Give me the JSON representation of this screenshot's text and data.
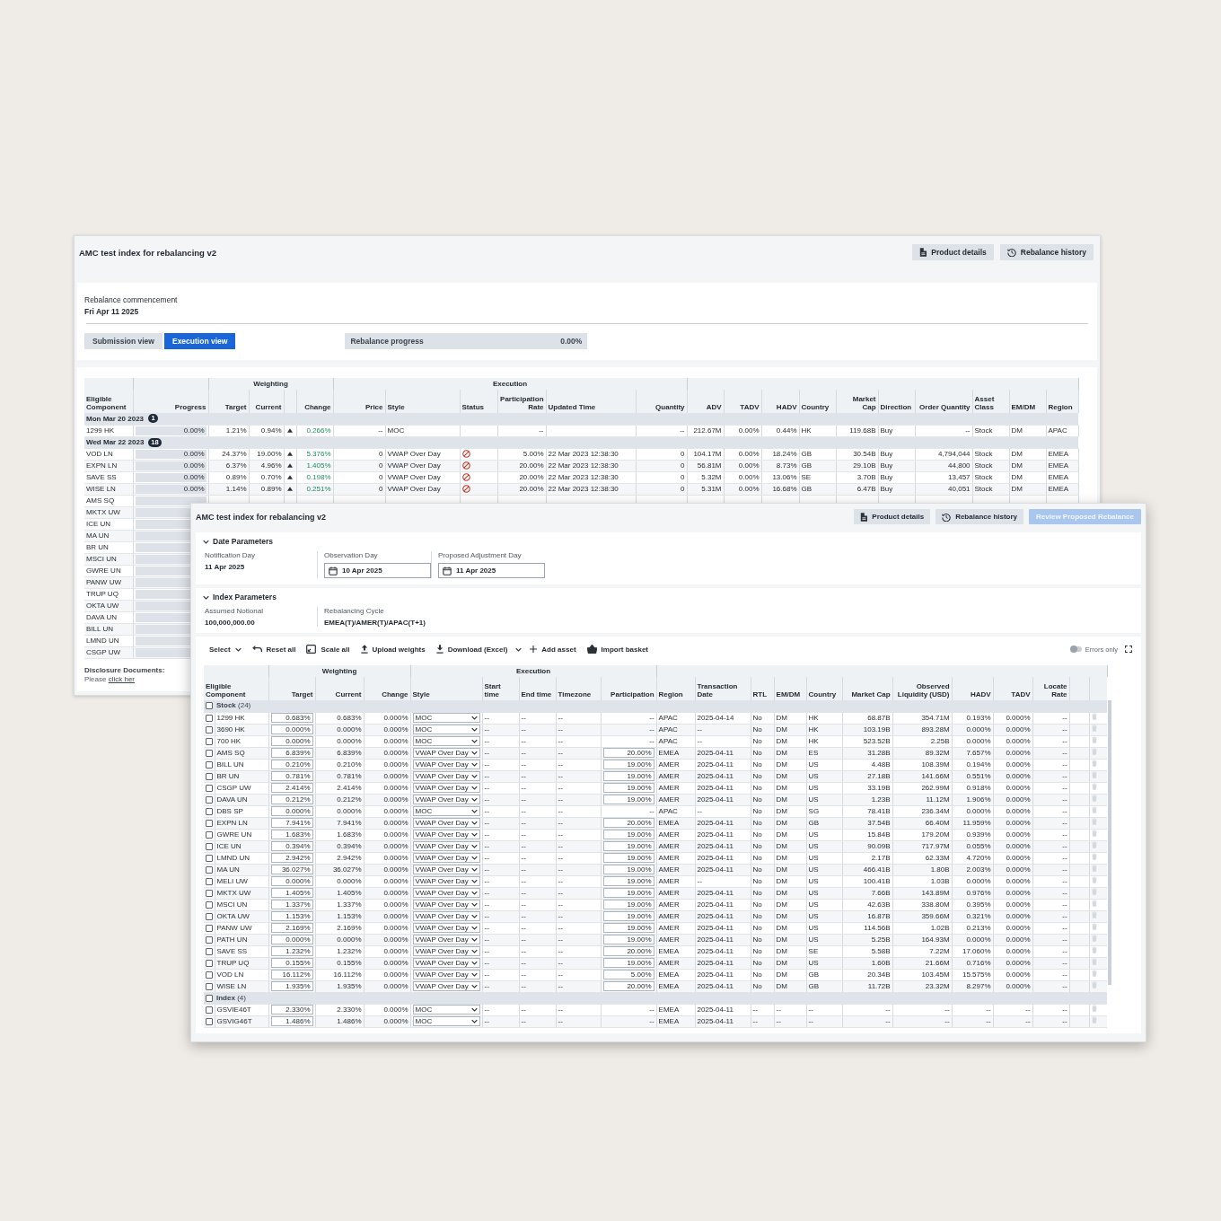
{
  "back_window": {
    "title": "AMC test index for rebalancing v2",
    "buttons": [
      {
        "label": "Product details"
      },
      {
        "label": "Rebalance history"
      }
    ],
    "commencement": {
      "label": "Rebalance commencement",
      "value": "Fri Apr 11 2025"
    },
    "view_tabs": [
      {
        "label": "Submission view",
        "selected": false
      },
      {
        "label": "Execution view",
        "selected": true
      }
    ],
    "progress": {
      "label": "Rebalance progress",
      "reading": "0.00%",
      "level": 0
    },
    "table": {
      "column_groups": [
        {
          "label": "Weighting"
        },
        {
          "label": "Execution"
        }
      ],
      "columns": [
        {
          "label": "Eligible Component"
        },
        {
          "label": "Progress",
          "kind": "progress"
        },
        {
          "label": "Target"
        },
        {
          "label": "Current"
        },
        {
          "kind": "trend"
        },
        {
          "label": "Change",
          "kind": "change"
        },
        {
          "label": "Price"
        },
        {
          "label": "Style"
        },
        {
          "label": "Status",
          "kind": "status"
        },
        {
          "label": "Participation Rate"
        },
        {
          "label": "Updated Time"
        },
        {
          "label": "Quantity"
        },
        {
          "label": "ADV"
        },
        {
          "label": "TADV"
        },
        {
          "label": "HADV"
        },
        {
          "label": "Country"
        },
        {
          "label": "Market Cap"
        },
        {
          "label": "Direction"
        },
        {
          "label": "Order Quantity"
        },
        {
          "label": "Asset Class"
        },
        {
          "label": "EM/DM"
        },
        {
          "label": "Region"
        }
      ],
      "rows": [
        {
          "kind": "date",
          "label": "Mon Mar 20 2023",
          "count": "1"
        },
        {
          "kind": "item",
          "component": "1299 HK",
          "progress": "0.00%",
          "level": 0,
          "target": "1.21%",
          "current": "0.94%",
          "rising": true,
          "change": "0.266%",
          "price": "--",
          "style": "MOC",
          "blocked": false,
          "participation_rate": "--",
          "quantity": "--",
          "adv": "212.67M",
          "tadv": "0.00%",
          "hadv": "0.44%",
          "country": "HK",
          "market_cap": "119.68B",
          "direction": "Buy",
          "order_quantity": "--",
          "asset_class": "Stock",
          "em_dm": "DM",
          "region": "APAC"
        },
        {
          "kind": "date",
          "label": "Wed Mar 22 2023",
          "count": "18"
        },
        {
          "kind": "item",
          "component": "VOD LN",
          "progress": "0.00%",
          "level": 0,
          "target": "24.37%",
          "current": "19.00%",
          "rising": true,
          "change": "5.376%",
          "price": "0",
          "style": "VWAP Over Day",
          "blocked": true,
          "participation_rate": "5.00%",
          "updated_time": "22 Mar 2023 12:38:30",
          "quantity": "0",
          "adv": "104.17M",
          "tadv": "0.00%",
          "hadv": "18.24%",
          "country": "GB",
          "market_cap": "30.54B",
          "direction": "Buy",
          "order_quantity": "4,794,044",
          "asset_class": "Stock",
          "em_dm": "DM",
          "region": "EMEA"
        },
        {
          "kind": "item",
          "component": "EXPN LN",
          "progress": "0.00%",
          "level": 0,
          "target": "6.37%",
          "current": "4.96%",
          "rising": true,
          "change": "1.405%",
          "price": "0",
          "style": "VWAP Over Day",
          "blocked": true,
          "participation_rate": "20.00%",
          "updated_time": "22 Mar 2023 12:38:30",
          "quantity": "0",
          "adv": "56.81M",
          "tadv": "0.00%",
          "hadv": "8.73%",
          "country": "GB",
          "market_cap": "29.10B",
          "direction": "Buy",
          "order_quantity": "44,800",
          "asset_class": "Stock",
          "em_dm": "DM",
          "region": "EMEA"
        },
        {
          "kind": "item",
          "component": "SAVE SS",
          "progress": "0.00%",
          "level": 0,
          "target": "0.89%",
          "current": "0.70%",
          "rising": true,
          "change": "0.198%",
          "price": "0",
          "style": "VWAP Over Day",
          "blocked": true,
          "participation_rate": "20.00%",
          "updated_time": "22 Mar 2023 12:38:30",
          "quantity": "0",
          "adv": "5.32M",
          "tadv": "0.00%",
          "hadv": "13.06%",
          "country": "SE",
          "market_cap": "3.70B",
          "direction": "Buy",
          "order_quantity": "13,457",
          "asset_class": "Stock",
          "em_dm": "DM",
          "region": "EMEA"
        },
        {
          "kind": "item",
          "component": "WISE LN",
          "progress": "0.00%",
          "level": 0,
          "target": "1.14%",
          "current": "0.89%",
          "rising": true,
          "change": "0.251%",
          "price": "0",
          "style": "VWAP Over Day",
          "blocked": true,
          "participation_rate": "20.00%",
          "updated_time": "22 Mar 2023 12:38:30",
          "quantity": "0",
          "adv": "5.31M",
          "tadv": "0.00%",
          "hadv": "16.68%",
          "country": "GB",
          "market_cap": "6.47B",
          "direction": "Buy",
          "order_quantity": "40,051",
          "asset_class": "Stock",
          "em_dm": "DM",
          "region": "EMEA"
        },
        {
          "kind": "item",
          "component": "AMS SQ",
          "level": 0
        },
        {
          "kind": "item",
          "component": "MKTX UW",
          "level": 0
        },
        {
          "kind": "item",
          "component": "ICE UN",
          "level": 0
        },
        {
          "kind": "item",
          "component": "MA UN",
          "level": 0
        },
        {
          "kind": "item",
          "component": "BR UN",
          "level": 0
        },
        {
          "kind": "item",
          "component": "MSCI UN",
          "level": 0
        },
        {
          "kind": "item",
          "component": "GWRE UN",
          "level": 0
        },
        {
          "kind": "item",
          "component": "PANW UW",
          "level": 0
        },
        {
          "kind": "item",
          "component": "TRUP UQ",
          "level": 0
        },
        {
          "kind": "item",
          "component": "OKTA UW",
          "level": 0
        },
        {
          "kind": "item",
          "component": "DAVA UN",
          "level": 0
        },
        {
          "kind": "item",
          "component": "BILL UN",
          "level": 0
        },
        {
          "kind": "item",
          "component": "LMND UN",
          "level": 0
        },
        {
          "kind": "item",
          "component": "CSGP UW",
          "level": 0
        }
      ]
    },
    "disclosure": {
      "text": "**Disclosure Documents:** Please",
      "link": "click her"
    }
  },
  "front_window": {
    "title": "AMC test index for rebalancing v2",
    "buttons": [
      {
        "label": "Product details",
        "kind": "secondary",
        "disabled": false
      },
      {
        "label": "Rebalance history",
        "kind": "secondary",
        "disabled": false
      },
      {
        "label": "Review Proposed Rebalance",
        "kind": "primary",
        "disabled": true
      }
    ],
    "sections": [
      {
        "title": "Date Parameters",
        "expanded": true,
        "fields": [
          {
            "label": "Notification Day",
            "value": "11 Apr 2025",
            "kind": "text"
          },
          {
            "label": "Observation Day",
            "value": "10 Apr 2025",
            "kind": "date"
          },
          {
            "label": "Proposed Adjustment Day",
            "value": "11 Apr 2025",
            "kind": "date"
          }
        ]
      },
      {
        "title": "Index Parameters",
        "expanded": true,
        "fields": [
          {
            "label": "Assumed Notional",
            "value": "100,000,000.00",
            "kind": "text"
          },
          {
            "label": "Rebalancing Cycle",
            "value": "EMEA(T)/AMER(T)/APAC(T+1)",
            "kind": "text"
          }
        ]
      }
    ],
    "toolbar": [
      {
        "label": "Select",
        "kind": "menu"
      },
      {
        "label": "Reset all",
        "kind": "button"
      },
      {
        "label": "Scale all",
        "kind": "button"
      },
      {
        "label": "Upload weights",
        "kind": "button"
      },
      {
        "label": "Download (Excel)",
        "kind": "split"
      },
      {
        "label": "Add asset",
        "kind": "button"
      },
      {
        "label": "Import basket",
        "kind": "button"
      }
    ],
    "errors_toggle": {
      "label": "Errors only",
      "on": false
    },
    "table": {
      "column_groups": [
        {
          "label": "Weighting"
        },
        {
          "label": "Execution"
        }
      ],
      "columns": [
        {
          "label": "Eligible Component"
        },
        {
          "label": "Target",
          "kind": "field"
        },
        {
          "label": "Current"
        },
        {
          "label": "Change"
        },
        {
          "label": "Style",
          "kind": "select"
        },
        {
          "label": "Start time"
        },
        {
          "label": "End time"
        },
        {
          "label": "Timezone"
        },
        {
          "label": "Participation",
          "kind": "participation"
        },
        {
          "label": "Region"
        },
        {
          "label": "Transaction Date"
        },
        {
          "label": "RTL"
        },
        {
          "label": "EM/DM"
        },
        {
          "label": "Country"
        },
        {
          "label": "Market Cap"
        },
        {
          "label": "Observed Liquidity (USD)"
        },
        {
          "label": "HADV"
        },
        {
          "label": "TADV"
        },
        {
          "label": "Locate Rate"
        }
      ],
      "rows": [
        {
          "kind": "group",
          "label": "**Stock** (24)",
          "checked": false
        },
        {
          "kind": "asset",
          "checked": false,
          "component": "1299 HK",
          "target": "0.683%",
          "current": "0.683%",
          "change": "0.000%",
          "style": "MOC",
          "start_time": "--",
          "end_time": "--",
          "timezone": "--",
          "participation": "--",
          "participation_editable": false,
          "region": "APAC",
          "transaction_date": "2025-04-14",
          "rtl": "No",
          "em_dm": "DM",
          "country": "HK",
          "market_cap": "68.87B",
          "observed_liquidity": "354.71M",
          "hadv": "0.193%",
          "tadv": "0.000%",
          "locate_rate": "--"
        },
        {
          "kind": "asset",
          "checked": false,
          "component": "3690 HK",
          "target": "0.000%",
          "current": "0.000%",
          "change": "0.000%",
          "style": "MOC",
          "start_time": "--",
          "end_time": "--",
          "timezone": "--",
          "participation": "--",
          "participation_editable": false,
          "region": "APAC",
          "transaction_date": "--",
          "rtl": "No",
          "em_dm": "DM",
          "country": "HK",
          "market_cap": "103.19B",
          "observed_liquidity": "893.28M",
          "hadv": "0.000%",
          "tadv": "0.000%",
          "locate_rate": "--"
        },
        {
          "kind": "asset",
          "checked": false,
          "component": "700 HK",
          "target": "0.000%",
          "current": "0.000%",
          "change": "0.000%",
          "style": "MOC",
          "start_time": "--",
          "end_time": "--",
          "timezone": "--",
          "participation": "--",
          "participation_editable": false,
          "region": "APAC",
          "transaction_date": "--",
          "rtl": "No",
          "em_dm": "DM",
          "country": "HK",
          "market_cap": "523.52B",
          "observed_liquidity": "2.25B",
          "hadv": "0.000%",
          "tadv": "0.000%",
          "locate_rate": "--"
        },
        {
          "kind": "asset",
          "checked": false,
          "component": "AMS SQ",
          "target": "6.839%",
          "current": "6.839%",
          "change": "0.000%",
          "style": "VWAP Over Day",
          "start_time": "--",
          "end_time": "--",
          "timezone": "--",
          "participation": "20.00%",
          "participation_editable": true,
          "region": "EMEA",
          "transaction_date": "2025-04-11",
          "rtl": "No",
          "em_dm": "DM",
          "country": "ES",
          "market_cap": "31.28B",
          "observed_liquidity": "89.32M",
          "hadv": "7.657%",
          "tadv": "0.000%",
          "locate_rate": "--"
        },
        {
          "kind": "asset",
          "checked": false,
          "component": "BILL UN",
          "target": "0.210%",
          "current": "0.210%",
          "change": "0.000%",
          "style": "VWAP Over Day",
          "start_time": "--",
          "end_time": "--",
          "timezone": "--",
          "participation": "19.00%",
          "participation_editable": true,
          "region": "AMER",
          "transaction_date": "2025-04-11",
          "rtl": "No",
          "em_dm": "DM",
          "country": "US",
          "market_cap": "4.48B",
          "observed_liquidity": "108.39M",
          "hadv": "0.194%",
          "tadv": "0.000%",
          "locate_rate": "--"
        },
        {
          "kind": "asset",
          "checked": false,
          "component": "BR UN",
          "target": "0.781%",
          "current": "0.781%",
          "change": "0.000%",
          "style": "VWAP Over Day",
          "start_time": "--",
          "end_time": "--",
          "timezone": "--",
          "participation": "19.00%",
          "participation_editable": true,
          "region": "AMER",
          "transaction_date": "2025-04-11",
          "rtl": "No",
          "em_dm": "DM",
          "country": "US",
          "market_cap": "27.18B",
          "observed_liquidity": "141.66M",
          "hadv": "0.551%",
          "tadv": "0.000%",
          "locate_rate": "--"
        },
        {
          "kind": "asset",
          "checked": false,
          "component": "CSGP UW",
          "target": "2.414%",
          "current": "2.414%",
          "change": "0.000%",
          "style": "VWAP Over Day",
          "start_time": "--",
          "end_time": "--",
          "timezone": "--",
          "participation": "19.00%",
          "participation_editable": true,
          "region": "AMER",
          "transaction_date": "2025-04-11",
          "rtl": "No",
          "em_dm": "DM",
          "country": "US",
          "market_cap": "33.19B",
          "observed_liquidity": "262.99M",
          "hadv": "0.918%",
          "tadv": "0.000%",
          "locate_rate": "--"
        },
        {
          "kind": "asset",
          "checked": false,
          "component": "DAVA UN",
          "target": "0.212%",
          "current": "0.212%",
          "change": "0.000%",
          "style": "VWAP Over Day",
          "start_time": "--",
          "end_time": "--",
          "timezone": "--",
          "participation": "19.00%",
          "participation_editable": true,
          "region": "AMER",
          "transaction_date": "2025-04-11",
          "rtl": "No",
          "em_dm": "DM",
          "country": "US",
          "market_cap": "1.23B",
          "observed_liquidity": "11.12M",
          "hadv": "1.906%",
          "tadv": "0.000%",
          "locate_rate": "--"
        },
        {
          "kind": "asset",
          "checked": false,
          "component": "DBS SP",
          "target": "0.000%",
          "current": "0.000%",
          "change": "0.000%",
          "style": "MOC",
          "start_time": "--",
          "end_time": "--",
          "timezone": "--",
          "participation": "--",
          "participation_editable": false,
          "region": "APAC",
          "transaction_date": "--",
          "rtl": "No",
          "em_dm": "DM",
          "country": "SG",
          "market_cap": "78.41B",
          "observed_liquidity": "236.34M",
          "hadv": "0.000%",
          "tadv": "0.000%",
          "locate_rate": "--"
        },
        {
          "kind": "asset",
          "checked": false,
          "component": "EXPN LN",
          "target": "7.941%",
          "current": "7.941%",
          "change": "0.000%",
          "style": "VWAP Over Day",
          "start_time": "--",
          "end_time": "--",
          "timezone": "--",
          "participation": "20.00%",
          "participation_editable": true,
          "region": "EMEA",
          "transaction_date": "2025-04-11",
          "rtl": "No",
          "em_dm": "DM",
          "country": "GB",
          "market_cap": "37.54B",
          "observed_liquidity": "66.40M",
          "hadv": "11.959%",
          "tadv": "0.000%",
          "locate_rate": "--"
        },
        {
          "kind": "asset",
          "checked": false,
          "component": "GWRE UN",
          "target": "1.683%",
          "current": "1.683%",
          "change": "0.000%",
          "style": "VWAP Over Day",
          "start_time": "--",
          "end_time": "--",
          "timezone": "--",
          "participation": "19.00%",
          "participation_editable": true,
          "region": "AMER",
          "transaction_date": "2025-04-11",
          "rtl": "No",
          "em_dm": "DM",
          "country": "US",
          "market_cap": "15.84B",
          "observed_liquidity": "179.20M",
          "hadv": "0.939%",
          "tadv": "0.000%",
          "locate_rate": "--"
        },
        {
          "kind": "asset",
          "checked": false,
          "component": "ICE UN",
          "target": "0.394%",
          "current": "0.394%",
          "change": "0.000%",
          "style": "VWAP Over Day",
          "start_time": "--",
          "end_time": "--",
          "timezone": "--",
          "participation": "19.00%",
          "participation_editable": true,
          "region": "AMER",
          "transaction_date": "2025-04-11",
          "rtl": "No",
          "em_dm": "DM",
          "country": "US",
          "market_cap": "90.09B",
          "observed_liquidity": "717.97M",
          "hadv": "0.055%",
          "tadv": "0.000%",
          "locate_rate": "--"
        },
        {
          "kind": "asset",
          "checked": false,
          "component": "LMND UN",
          "target": "2.942%",
          "current": "2.942%",
          "change": "0.000%",
          "style": "VWAP Over Day",
          "start_time": "--",
          "end_time": "--",
          "timezone": "--",
          "participation": "19.00%",
          "participation_editable": true,
          "region": "AMER",
          "transaction_date": "2025-04-11",
          "rtl": "No",
          "em_dm": "DM",
          "country": "US",
          "market_cap": "2.17B",
          "observed_liquidity": "62.33M",
          "hadv": "4.720%",
          "tadv": "0.000%",
          "locate_rate": "--"
        },
        {
          "kind": "asset",
          "checked": false,
          "component": "MA UN",
          "target": "36.027%",
          "current": "36.027%",
          "change": "0.000%",
          "style": "VWAP Over Day",
          "start_time": "--",
          "end_time": "--",
          "timezone": "--",
          "participation": "19.00%",
          "participation_editable": true,
          "region": "AMER",
          "transaction_date": "2025-04-11",
          "rtl": "No",
          "em_dm": "DM",
          "country": "US",
          "market_cap": "466.41B",
          "observed_liquidity": "1.80B",
          "hadv": "2.003%",
          "tadv": "0.000%",
          "locate_rate": "--"
        },
        {
          "kind": "asset",
          "checked": false,
          "component": "MELI UW",
          "target": "0.000%",
          "current": "0.000%",
          "change": "0.000%",
          "style": "VWAP Over Day",
          "start_time": "--",
          "end_time": "--",
          "timezone": "--",
          "participation": "19.00%",
          "participation_editable": true,
          "region": "AMER",
          "transaction_date": "--",
          "rtl": "No",
          "em_dm": "DM",
          "country": "US",
          "market_cap": "100.41B",
          "observed_liquidity": "1.03B",
          "hadv": "0.000%",
          "tadv": "0.000%",
          "locate_rate": "--"
        },
        {
          "kind": "asset",
          "checked": false,
          "component": "MKTX UW",
          "target": "1.405%",
          "current": "1.405%",
          "change": "0.000%",
          "style": "VWAP Over Day",
          "start_time": "--",
          "end_time": "--",
          "timezone": "--",
          "participation": "19.00%",
          "participation_editable": true,
          "region": "AMER",
          "transaction_date": "2025-04-11",
          "rtl": "No",
          "em_dm": "DM",
          "country": "US",
          "market_cap": "7.66B",
          "observed_liquidity": "143.89M",
          "hadv": "0.976%",
          "tadv": "0.000%",
          "locate_rate": "--"
        },
        {
          "kind": "asset",
          "checked": false,
          "component": "MSCI UN",
          "target": "1.337%",
          "current": "1.337%",
          "change": "0.000%",
          "style": "VWAP Over Day",
          "start_time": "--",
          "end_time": "--",
          "timezone": "--",
          "participation": "19.00%",
          "participation_editable": true,
          "region": "AMER",
          "transaction_date": "2025-04-11",
          "rtl": "No",
          "em_dm": "DM",
          "country": "US",
          "market_cap": "42.63B",
          "observed_liquidity": "338.80M",
          "hadv": "0.395%",
          "tadv": "0.000%",
          "locate_rate": "--"
        },
        {
          "kind": "asset",
          "checked": false,
          "component": "OKTA UW",
          "target": "1.153%",
          "current": "1.153%",
          "change": "0.000%",
          "style": "VWAP Over Day",
          "start_time": "--",
          "end_time": "--",
          "timezone": "--",
          "participation": "19.00%",
          "participation_editable": true,
          "region": "AMER",
          "transaction_date": "2025-04-11",
          "rtl": "No",
          "em_dm": "DM",
          "country": "US",
          "market_cap": "16.87B",
          "observed_liquidity": "359.66M",
          "hadv": "0.321%",
          "tadv": "0.000%",
          "locate_rate": "--"
        },
        {
          "kind": "asset",
          "checked": false,
          "component": "PANW UW",
          "target": "2.169%",
          "current": "2.169%",
          "change": "0.000%",
          "style": "VWAP Over Day",
          "start_time": "--",
          "end_time": "--",
          "timezone": "--",
          "participation": "19.00%",
          "participation_editable": true,
          "region": "AMER",
          "transaction_date": "2025-04-11",
          "rtl": "No",
          "em_dm": "DM",
          "country": "US",
          "market_cap": "114.56B",
          "observed_liquidity": "1.02B",
          "hadv": "0.213%",
          "tadv": "0.000%",
          "locate_rate": "--"
        },
        {
          "kind": "asset",
          "checked": false,
          "component": "PATH UN",
          "target": "0.000%",
          "current": "0.000%",
          "change": "0.000%",
          "style": "VWAP Over Day",
          "start_time": "--",
          "end_time": "--",
          "timezone": "--",
          "participation": "19.00%",
          "participation_editable": true,
          "region": "AMER",
          "transaction_date": "2025-04-11",
          "rtl": "No",
          "em_dm": "DM",
          "country": "US",
          "market_cap": "5.25B",
          "observed_liquidity": "164.93M",
          "hadv": "0.000%",
          "tadv": "0.000%",
          "locate_rate": "--"
        },
        {
          "kind": "asset",
          "checked": false,
          "component": "SAVE SS",
          "target": "1.232%",
          "current": "1.232%",
          "change": "0.000%",
          "style": "VWAP Over Day",
          "start_time": "--",
          "end_time": "--",
          "timezone": "--",
          "participation": "20.00%",
          "participation_editable": true,
          "region": "EMEA",
          "transaction_date": "2025-04-11",
          "rtl": "No",
          "em_dm": "DM",
          "country": "SE",
          "market_cap": "5.58B",
          "observed_liquidity": "7.22M",
          "hadv": "17.060%",
          "tadv": "0.000%",
          "locate_rate": "--"
        },
        {
          "kind": "asset",
          "checked": false,
          "component": "TRUP UQ",
          "target": "0.155%",
          "current": "0.155%",
          "change": "0.000%",
          "style": "VWAP Over Day",
          "start_time": "--",
          "end_time": "--",
          "timezone": "--",
          "participation": "19.00%",
          "participation_editable": true,
          "region": "AMER",
          "transaction_date": "2025-04-11",
          "rtl": "No",
          "em_dm": "DM",
          "country": "US",
          "market_cap": "1.60B",
          "observed_liquidity": "21.66M",
          "hadv": "0.716%",
          "tadv": "0.000%",
          "locate_rate": "--"
        },
        {
          "kind": "asset",
          "checked": false,
          "component": "VOD LN",
          "target": "16.112%",
          "current": "16.112%",
          "change": "0.000%",
          "style": "VWAP Over Day",
          "start_time": "--",
          "end_time": "--",
          "timezone": "--",
          "participation": "5.00%",
          "participation_editable": true,
          "region": "EMEA",
          "transaction_date": "2025-04-11",
          "rtl": "No",
          "em_dm": "DM",
          "country": "GB",
          "market_cap": "20.34B",
          "observed_liquidity": "103.45M",
          "hadv": "15.575%",
          "tadv": "0.000%",
          "locate_rate": "--"
        },
        {
          "kind": "asset",
          "checked": false,
          "component": "WISE LN",
          "target": "1.935%",
          "current": "1.935%",
          "change": "0.000%",
          "style": "VWAP Over Day",
          "start_time": "--",
          "end_time": "--",
          "timezone": "--",
          "participation": "20.00%",
          "participation_editable": true,
          "region": "EMEA",
          "transaction_date": "2025-04-11",
          "rtl": "No",
          "em_dm": "DM",
          "country": "GB",
          "market_cap": "11.72B",
          "observed_liquidity": "23.32M",
          "hadv": "8.297%",
          "tadv": "0.000%",
          "locate_rate": "--"
        },
        {
          "kind": "group",
          "label": "**Index** (4)",
          "checked": false
        },
        {
          "kind": "asset",
          "checked": false,
          "component": "GSVIE46T",
          "target": "2.330%",
          "current": "2.330%",
          "change": "0.000%",
          "style": "MOC",
          "start_time": "--",
          "end_time": "--",
          "timezone": "--",
          "participation": "--",
          "participation_editable": false,
          "region": "EMEA",
          "transaction_date": "2025-04-11",
          "rtl": "--",
          "em_dm": "--",
          "country": "--",
          "market_cap": "--",
          "observed_liquidity": "--",
          "hadv": "--",
          "tadv": "--",
          "locate_rate": "--"
        },
        {
          "kind": "asset",
          "checked": false,
          "component": "GSVIG46T",
          "target": "1.486%",
          "current": "1.486%",
          "change": "0.000%",
          "style": "MOC",
          "start_time": "--",
          "end_time": "--",
          "timezone": "--",
          "participation": "--",
          "participation_editable": false,
          "region": "EMEA",
          "transaction_date": "2025-04-11",
          "rtl": "--",
          "em_dm": "--",
          "country": "--",
          "market_cap": "--",
          "observed_liquidity": "--",
          "hadv": "--",
          "tadv": "--",
          "locate_rate": "--"
        }
      ]
    }
  }
}
